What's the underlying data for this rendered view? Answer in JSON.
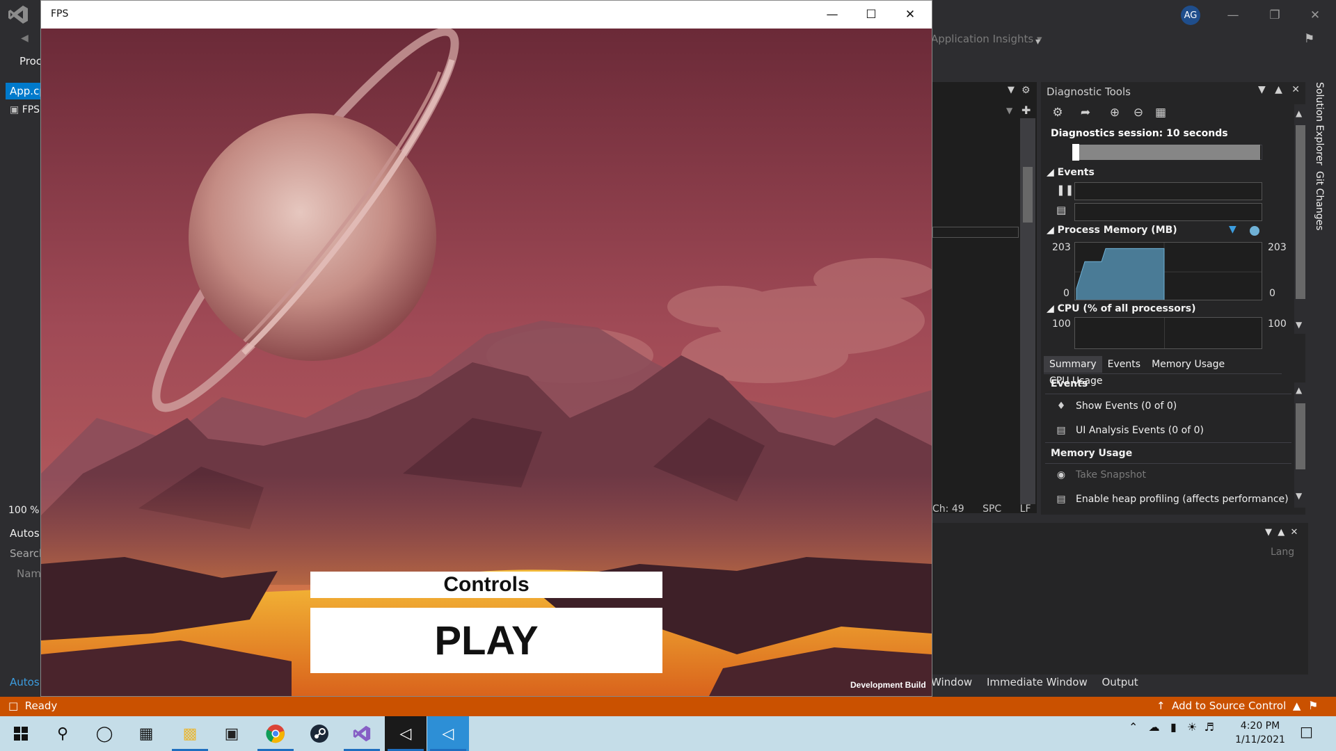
{
  "vs": {
    "account_initials": "AG",
    "toolbar_insights": "Application Insights",
    "left_proc": "Proc",
    "doc_tab": "App.cp",
    "doc_sub": "FPS",
    "zoom": "100 %",
    "autos_header": "Autos",
    "autos_search": "Search",
    "autos_name_col": "Nam",
    "autos_tab": "Autos",
    "editor_status": {
      "ch": "Ch: 49",
      "spc": "SPC",
      "lf": "LF"
    },
    "bottom_lang": "Lang",
    "bottom_tabs": [
      "Window",
      "Immediate Window",
      "Output"
    ]
  },
  "diagnostics": {
    "title": "Diagnostic Tools",
    "session": "Diagnostics session: 10 seconds",
    "events_label": "Events",
    "memory_label": "Process Memory (MB)",
    "memory_max": "203",
    "memory_min": "0",
    "memory_level": 0.9,
    "cpu_label": "CPU (% of all processors)",
    "cpu_max": "100",
    "tabs": [
      "Summary",
      "Events",
      "Memory Usage",
      "CPU Usage"
    ],
    "summary": {
      "events_head": "Events",
      "show_events": "Show Events (0 of 0)",
      "ui_events": "UI Analysis Events (0 of 0)",
      "memory_head": "Memory Usage",
      "take_snapshot": "Take Snapshot",
      "heap_profiling": "Enable heap profiling (affects performance)"
    }
  },
  "side_rail": [
    "Solution Explorer",
    "Git Changes"
  ],
  "statusbar": {
    "ready": "Ready",
    "source_control": "Add to Source Control",
    "color": "#ca5100"
  },
  "taskbar": {
    "time": "4:20 PM",
    "date": "1/11/2021"
  },
  "game": {
    "window_title": "FPS",
    "controls_button": "Controls",
    "play_button": "PLAY",
    "dev_build": "Development Build"
  },
  "colors": {
    "vs_accent": "#007acc",
    "sky": "#8a3c4c",
    "lava": "#f5a623"
  }
}
